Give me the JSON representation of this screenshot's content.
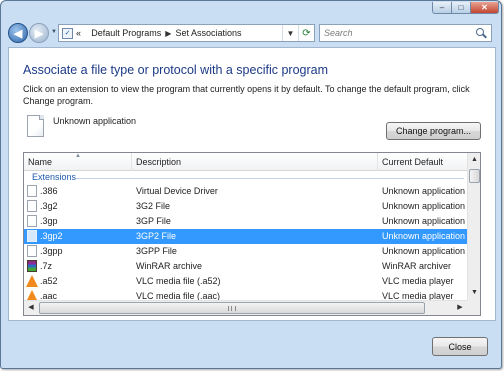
{
  "window": {
    "controls": {
      "minimize_glyph": "–",
      "maximize_glyph": "□",
      "close_glyph": "✕"
    }
  },
  "nav": {
    "back_glyph": "◀",
    "forward_glyph": "▶",
    "address_icon": "control-panel-icon",
    "breadcrumb": [
      "«",
      "Default Programs",
      "Set Associations"
    ],
    "search_placeholder": "Search"
  },
  "page": {
    "heading": "Associate a file type or protocol with a specific program",
    "description": "Click on an extension to view the program that currently opens it by default. To change the default program, click Change program.",
    "current_program": "Unknown application",
    "change_button": "Change program..."
  },
  "list": {
    "columns": [
      "Name",
      "Description",
      "Current Default"
    ],
    "sorted_by": "Name",
    "group": "Extensions",
    "rows": [
      {
        "name": ".386",
        "description": "Virtual Device Driver",
        "default": "Unknown application",
        "icon": "document-icon",
        "selected": false
      },
      {
        "name": ".3g2",
        "description": "3G2 File",
        "default": "Unknown application",
        "icon": "document-icon",
        "selected": false
      },
      {
        "name": ".3gp",
        "description": "3GP File",
        "default": "Unknown application",
        "icon": "document-icon",
        "selected": false
      },
      {
        "name": ".3gp2",
        "description": "3GP2 File",
        "default": "Unknown application",
        "icon": "document-icon",
        "selected": true
      },
      {
        "name": ".3gpp",
        "description": "3GPP File",
        "default": "Unknown application",
        "icon": "document-icon",
        "selected": false
      },
      {
        "name": ".7z",
        "description": "WinRAR archive",
        "default": "WinRAR archiver",
        "icon": "winrar-icon",
        "selected": false
      },
      {
        "name": ".a52",
        "description": "VLC media file (.a52)",
        "default": "VLC media player",
        "icon": "vlc-icon",
        "selected": false
      },
      {
        "name": ".aac",
        "description": "VLC media file (.aac)",
        "default": "VLC media player",
        "icon": "vlc-icon",
        "selected": false
      }
    ]
  },
  "footer": {
    "close_button": "Close"
  },
  "colors": {
    "selection": "#3399ff",
    "heading": "#1c3a87",
    "group": "#1e5ab0"
  }
}
